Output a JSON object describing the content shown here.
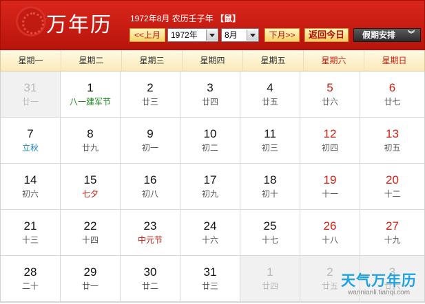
{
  "header": {
    "logo_text": "万年历",
    "date_line": "1972年8月 农历壬子年",
    "zodiac_open": "【",
    "zodiac": "鼠",
    "zodiac_close": "】",
    "prev_month_label": "<<上月",
    "year_value": "1972年",
    "month_value": "8月",
    "next_month_label": "下月>>",
    "today_label": "返回今日",
    "holiday_label": "假期安排",
    "holiday_chevron": "︾"
  },
  "weekdays": [
    {
      "label": "星期一",
      "weekend": false
    },
    {
      "label": "星期二",
      "weekend": false
    },
    {
      "label": "星期三",
      "weekend": false
    },
    {
      "label": "星期四",
      "weekend": false
    },
    {
      "label": "星期五",
      "weekend": false
    },
    {
      "label": "星期六",
      "weekend": true
    },
    {
      "label": "星期日",
      "weekend": true
    }
  ],
  "days": [
    {
      "day": "31",
      "lunar": "廿一",
      "dim": true
    },
    {
      "day": "1",
      "lunar": "八一建军节",
      "hl": "green"
    },
    {
      "day": "2",
      "lunar": "廿三"
    },
    {
      "day": "3",
      "lunar": "廿四"
    },
    {
      "day": "4",
      "lunar": "廿五"
    },
    {
      "day": "5",
      "lunar": "廿六",
      "weekend": true
    },
    {
      "day": "6",
      "lunar": "廿七",
      "weekend": true
    },
    {
      "day": "7",
      "lunar": "立秋",
      "hl": "teal"
    },
    {
      "day": "8",
      "lunar": "廿九"
    },
    {
      "day": "9",
      "lunar": "初一"
    },
    {
      "day": "10",
      "lunar": "初二"
    },
    {
      "day": "11",
      "lunar": "初三"
    },
    {
      "day": "12",
      "lunar": "初四",
      "weekend": true
    },
    {
      "day": "13",
      "lunar": "初五",
      "weekend": true
    },
    {
      "day": "14",
      "lunar": "初六"
    },
    {
      "day": "15",
      "lunar": "七夕",
      "hl": "red"
    },
    {
      "day": "16",
      "lunar": "初八"
    },
    {
      "day": "17",
      "lunar": "初九"
    },
    {
      "day": "18",
      "lunar": "初十"
    },
    {
      "day": "19",
      "lunar": "十一",
      "weekend": true
    },
    {
      "day": "20",
      "lunar": "十二",
      "weekend": true
    },
    {
      "day": "21",
      "lunar": "十三"
    },
    {
      "day": "22",
      "lunar": "十四"
    },
    {
      "day": "23",
      "lunar": "中元节",
      "hl": "red"
    },
    {
      "day": "24",
      "lunar": "十六"
    },
    {
      "day": "25",
      "lunar": "十七"
    },
    {
      "day": "26",
      "lunar": "十八",
      "weekend": true
    },
    {
      "day": "27",
      "lunar": "十九",
      "weekend": true
    },
    {
      "day": "28",
      "lunar": "二十"
    },
    {
      "day": "29",
      "lunar": "廿一"
    },
    {
      "day": "30",
      "lunar": "廿二"
    },
    {
      "day": "31",
      "lunar": "廿三"
    },
    {
      "day": "1",
      "lunar": "廿四",
      "dim": true
    },
    {
      "day": "2",
      "lunar": "廿五",
      "dim": true
    },
    {
      "day": "3",
      "lunar": "廿六",
      "dim": true
    }
  ],
  "watermark": {
    "title": "天气万年历",
    "subtitle": "wannianli.tianqi.com"
  },
  "colors": {
    "header_red": "#c81a10",
    "weekend_red": "#d11d10",
    "button_yellow": "#f5d36b",
    "watermark_blue": "#1fa2e0"
  }
}
